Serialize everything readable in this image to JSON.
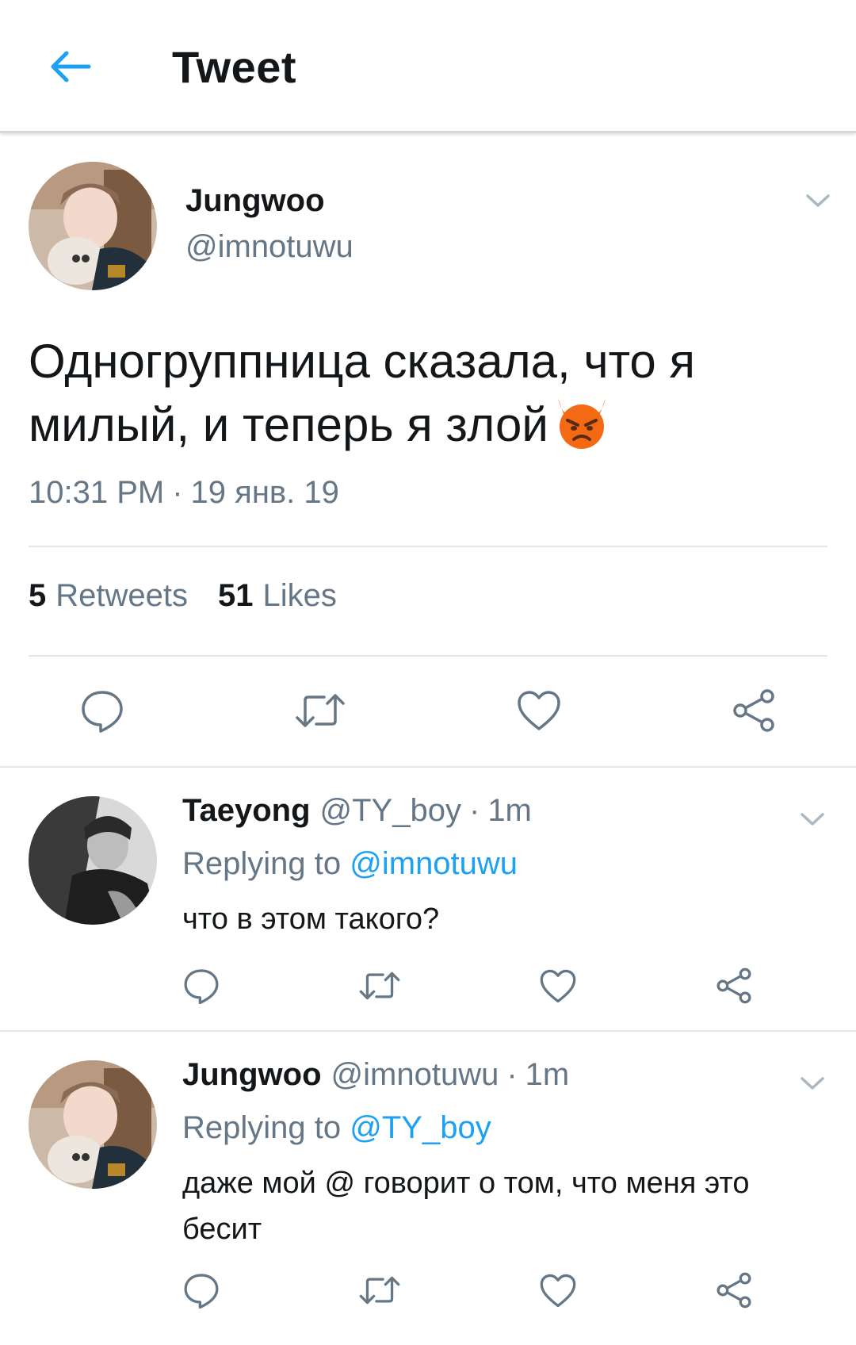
{
  "header": {
    "title": "Tweet",
    "back_icon": "back-arrow-icon",
    "accent": "#1da1f2"
  },
  "tweet": {
    "name": "Jungwoo",
    "handle": "@imnotuwu",
    "text": "Одногруппница сказала, что я милый, и теперь я злой",
    "emoji": "angry-devil-emoji",
    "time": "10:31 PM",
    "date": "19 янв. 19",
    "retweets_count": "5",
    "retweets_label": "Retweets",
    "likes_count": "51",
    "likes_label": "Likes"
  },
  "replies": [
    {
      "name": "Taeyong",
      "handle": "@TY_boy",
      "age": "1m",
      "replying_label": "Replying to",
      "replying_to": "@imnotuwu",
      "text": "что в этом такого?"
    },
    {
      "name": "Jungwoo",
      "handle": "@imnotuwu",
      "age": "1m",
      "replying_label": "Replying to",
      "replying_to": "@TY_boy",
      "text": "даже мой @ говорит о том, что меня это бесит"
    }
  ],
  "colors": {
    "text_primary": "#14171a",
    "text_secondary": "#657786",
    "link": "#1da1f2",
    "divider": "#e1e8ed"
  }
}
